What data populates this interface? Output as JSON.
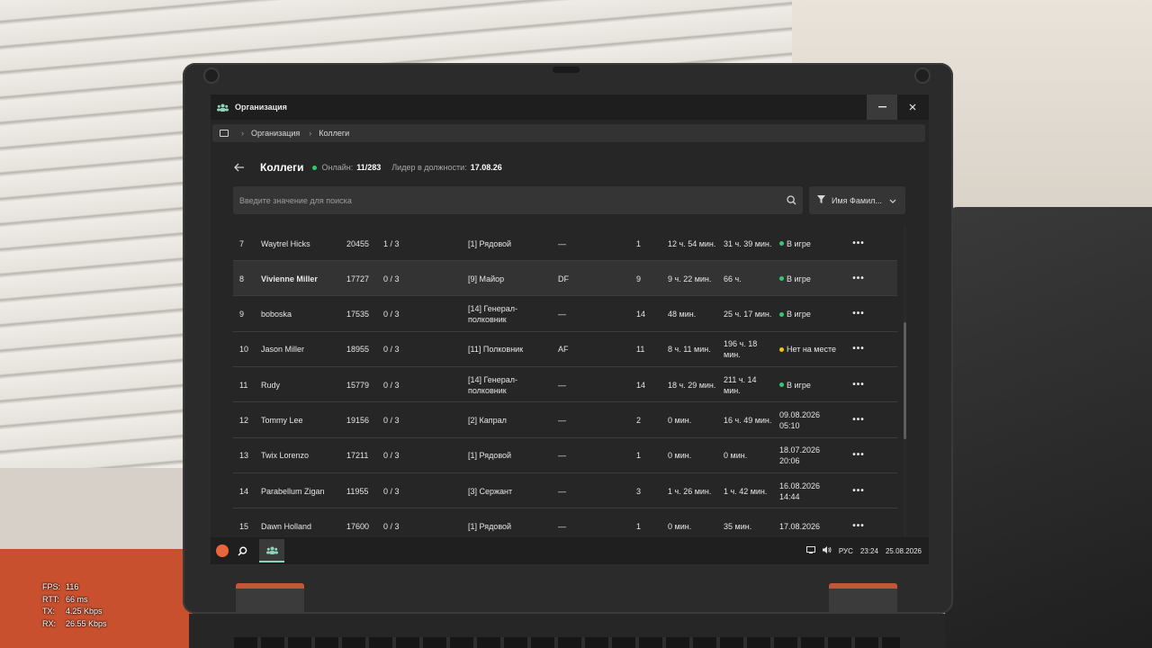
{
  "window": {
    "title": "Организация"
  },
  "breadcrumb": [
    "Организация",
    "Коллеги"
  ],
  "header": {
    "title": "Коллеги",
    "online_label": "Онлайн:",
    "online_value": "11/283",
    "leader_label": "Лидер в должности:",
    "leader_value": "17.08.26"
  },
  "search": {
    "placeholder": "Введите значение для поиска"
  },
  "sort": {
    "label": "Имя Фамил..."
  },
  "colors": {
    "online": "#2ecc71",
    "away": "#f1c40f",
    "accent": "#8fd3b8"
  },
  "rows": [
    {
      "num": "7",
      "name": "Waytrel Hicks",
      "id": "20455",
      "warn": "1 / 3",
      "rank": "[1] Рядовой",
      "tag": "—",
      "lvl": "1",
      "t1": "12 ч. 54 мин.",
      "t2": "31 ч. 39 мин.",
      "status": "В игре",
      "status_type": "online"
    },
    {
      "num": "8",
      "name": "Vivienne Miller",
      "id": "17727",
      "warn": "0 / 3",
      "rank": "[9] Майор",
      "tag": "DF",
      "lvl": "9",
      "t1": "9 ч. 22 мин.",
      "t2": "66 ч.",
      "status": "В игре",
      "status_type": "online",
      "highlight": true
    },
    {
      "num": "9",
      "name": "boboska",
      "id": "17535",
      "warn": "0 / 3",
      "rank": "[14] Генерал-полковник",
      "tag": "—",
      "lvl": "14",
      "t1": "48 мин.",
      "t2": "25 ч. 17 мин.",
      "status": "В игре",
      "status_type": "online"
    },
    {
      "num": "10",
      "name": "Jason Miller",
      "id": "18955",
      "warn": "0 / 3",
      "rank": "[11] Полковник",
      "tag": "AF",
      "lvl": "11",
      "t1": "8 ч. 11 мин.",
      "t2": "196 ч. 18 мин.",
      "status": "Нет на месте",
      "status_type": "away"
    },
    {
      "num": "11",
      "name": "Rudy",
      "id": "15779",
      "warn": "0 / 3",
      "rank": "[14] Генерал-полковник",
      "tag": "—",
      "lvl": "14",
      "t1": "18 ч. 29 мин.",
      "t2": "211 ч. 14 мин.",
      "status": "В игре",
      "status_type": "online"
    },
    {
      "num": "12",
      "name": "Tommy Lee",
      "id": "19156",
      "warn": "0 / 3",
      "rank": "[2] Капрал",
      "tag": "—",
      "lvl": "2",
      "t1": "0 мин.",
      "t2": "16 ч. 49 мин.",
      "status": "09.08.2026 05:10",
      "status_type": "offline"
    },
    {
      "num": "13",
      "name": "Twix Lorenzo",
      "id": "17211",
      "warn": "0 / 3",
      "rank": "[1] Рядовой",
      "tag": "—",
      "lvl": "1",
      "t1": "0 мин.",
      "t2": "0 мин.",
      "status": "18.07.2026 20:06",
      "status_type": "offline"
    },
    {
      "num": "14",
      "name": "Parabellum Zigan",
      "id": "11955",
      "warn": "0 / 3",
      "rank": "[3] Сержант",
      "tag": "—",
      "lvl": "3",
      "t1": "1 ч. 26 мин.",
      "t2": "1 ч. 42 мин.",
      "status": "16.08.2026 14:44",
      "status_type": "offline"
    },
    {
      "num": "15",
      "name": "Dawn Holland",
      "id": "17600",
      "warn": "0 / 3",
      "rank": "[1] Рядовой",
      "tag": "—",
      "lvl": "1",
      "t1": "0 мин.",
      "t2": "35 мин.",
      "status": "17.08.2026",
      "status_type": "offline"
    }
  ],
  "row_more_label": "•••",
  "taskbar": {
    "lang": "РУС",
    "time": "23:24",
    "date": "25.08.2026"
  },
  "stats": [
    {
      "k": "FPS:",
      "v": "116"
    },
    {
      "k": "RTT:",
      "v": "66 ms"
    },
    {
      "k": "TX:",
      "v": "4.25 Kbps"
    },
    {
      "k": "RX:",
      "v": "26.55 Kbps"
    }
  ]
}
